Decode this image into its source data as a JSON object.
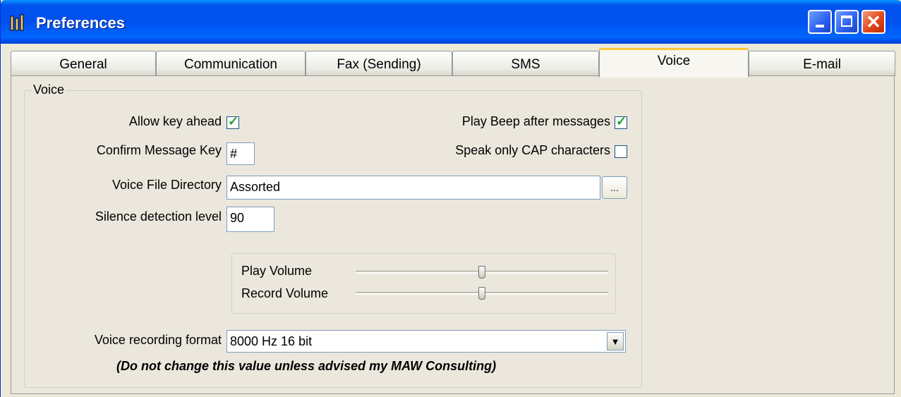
{
  "window": {
    "title": "Preferences",
    "app_icon": "tool-icon"
  },
  "tabs": [
    {
      "label": "General",
      "active": false
    },
    {
      "label": "Communication",
      "active": false
    },
    {
      "label": "Fax (Sending)",
      "active": false
    },
    {
      "label": "SMS",
      "active": false
    },
    {
      "label": "Voice",
      "active": true
    },
    {
      "label": "E-mail",
      "active": false
    }
  ],
  "voice": {
    "group_title": "Voice",
    "allow_key_ahead": {
      "label": "Allow key ahead",
      "checked": true
    },
    "play_beep": {
      "label": "Play Beep after messages",
      "checked": true
    },
    "speak_cap": {
      "label": "Speak only CAP characters",
      "checked": false
    },
    "confirm_key": {
      "label": "Confirm Message Key",
      "value": "#"
    },
    "voice_dir": {
      "label": "Voice File Directory",
      "value": "Assorted",
      "browse": "..."
    },
    "silence": {
      "label": "Silence detection level",
      "value": "90"
    },
    "play_volume": {
      "label": "Play Volume",
      "level": 0.5
    },
    "record_volume": {
      "label": "Record Volume",
      "level": 0.5
    },
    "format": {
      "label": "Voice recording format",
      "value": "8000 Hz 16 bit"
    },
    "note": "(Do not change this value unless advised my MAW Consulting)"
  }
}
